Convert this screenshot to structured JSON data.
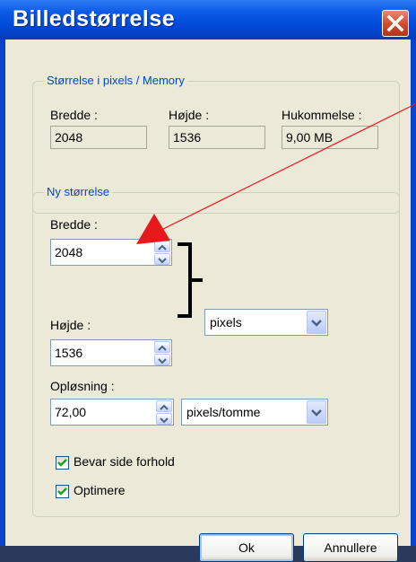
{
  "window": {
    "title": "Billedstørrelse"
  },
  "size_group": {
    "legend": "Størrelse i pixels / Memory",
    "width_label": "Bredde :",
    "height_label": "Højde :",
    "memory_label": "Hukommelse :",
    "width_value": "2048",
    "height_value": "1536",
    "memory_value": "9,00 MB"
  },
  "new_size_group": {
    "legend": "Ny størrelse",
    "width_label": "Bredde :",
    "width_value": "2048",
    "height_label": "Højde :",
    "height_value": "1536",
    "unit_selected": "pixels",
    "resolution_label": "Opløsning :",
    "resolution_value": "72,00",
    "resolution_unit_selected": "pixels/tomme",
    "keep_aspect_label": "Bevar side forhold",
    "keep_aspect_checked": true,
    "optimize_label": "Optimere",
    "optimize_checked": true
  },
  "buttons": {
    "ok_label": "Ok",
    "cancel_label": "Annullere"
  },
  "colors": {
    "title_bar": "#0a4fd9",
    "legend_text": "#0046d5",
    "dialog_bg": "#ece9d8",
    "annotation_red": "#e8191b",
    "close_button": "#d2492a"
  },
  "icons": {
    "close": "close-icon",
    "spin_up": "chevron-up-icon",
    "spin_down": "chevron-down-icon",
    "dropdown": "chevron-down-icon",
    "check": "check-icon"
  }
}
